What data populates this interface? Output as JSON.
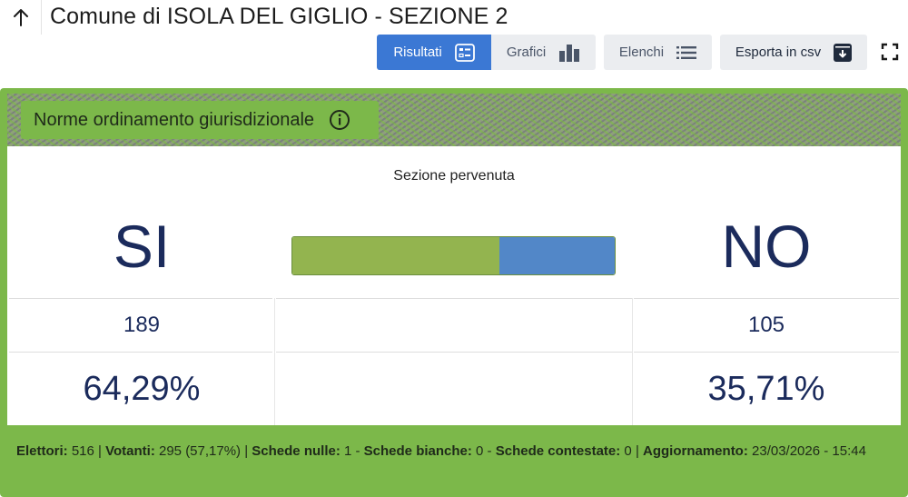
{
  "header": {
    "back_icon": "arrow-up-icon",
    "title": "Comune di ISOLA DEL GIGLIO - SEZIONE 2"
  },
  "toolbar": {
    "risultati": {
      "label": "Risultati",
      "icon": "list-check-icon",
      "active": true
    },
    "grafici": {
      "label": "Grafici",
      "icon": "bar-chart-icon"
    },
    "elenchi": {
      "label": "Elenchi",
      "icon": "list-icon"
    },
    "esporta": {
      "label": "Esporta in csv",
      "icon": "archive-download-icon"
    },
    "fullscreen_icon": "fullscreen-icon"
  },
  "quesito": {
    "title": "Norme ordinamento giurisdizionale",
    "info_icon": "info-icon"
  },
  "result": {
    "status": "Sezione pervenuta",
    "si": {
      "label": "SI",
      "votes": "189",
      "percent": "64,29%",
      "share": 0.6429,
      "color": "#93b44f"
    },
    "no": {
      "label": "NO",
      "votes": "105",
      "percent": "35,71%",
      "share": 0.3571,
      "color": "#5287c8"
    }
  },
  "footer": {
    "elettori_label": "Elettori:",
    "elettori_value": " 516 | ",
    "votanti_label": "Votanti:",
    "votanti_value": " 295 (57,17%) | ",
    "nulle_label": "Schede nulle:",
    "nulle_value": " 1 - ",
    "bianche_label": "Schede bianche:",
    "bianche_value": " 0 - ",
    "contestate_label": "Schede contestate:",
    "contestate_value": " 0 | ",
    "aggiornamento_label": "Aggiornamento:",
    "aggiornamento_value": " 23/03/2026 - 15:44"
  },
  "colors": {
    "primary": "#3b78d4",
    "accent_green": "#7cb84a",
    "text_navy": "#1b2b5c"
  }
}
